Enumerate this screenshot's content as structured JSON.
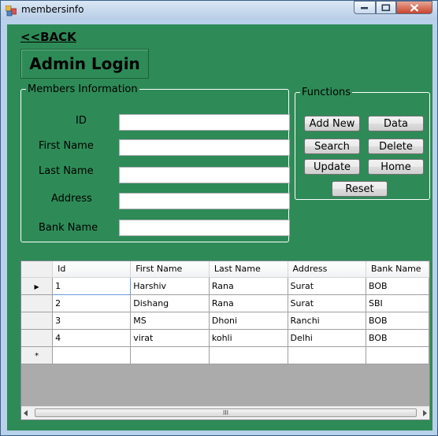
{
  "window": {
    "title": "membersinfo"
  },
  "back_link": "<<BACK",
  "admin_heading": "Admin Login",
  "members_group": {
    "legend": "Members Information",
    "fields": [
      {
        "label": "ID",
        "value": ""
      },
      {
        "label": "First Name",
        "value": ""
      },
      {
        "label": "Last Name",
        "value": ""
      },
      {
        "label": "Address",
        "value": ""
      },
      {
        "label": "Bank Name",
        "value": ""
      }
    ]
  },
  "functions_group": {
    "legend": "Functions",
    "buttons": {
      "add_new": "Add New",
      "data": "Data",
      "search": "Search",
      "delete": "Delete",
      "update": "Update",
      "home": "Home",
      "reset": "Reset"
    }
  },
  "grid": {
    "columns": [
      "Id",
      "First Name",
      "Last Name",
      "Address",
      "Bank Name"
    ],
    "rows": [
      [
        "1",
        "Harshiv",
        "Rana",
        "Surat",
        "BOB"
      ],
      [
        "2",
        "Dishang",
        "Rana",
        "Surat",
        "SBI"
      ],
      [
        "3",
        "MS",
        "Dhoni",
        "Ranchi",
        "BOB"
      ],
      [
        "4",
        "virat",
        "kohli",
        "Delhi",
        "BOB"
      ]
    ],
    "current_row_indicator": "▶",
    "new_row_indicator": "*",
    "scrollbar_grip": "III"
  }
}
